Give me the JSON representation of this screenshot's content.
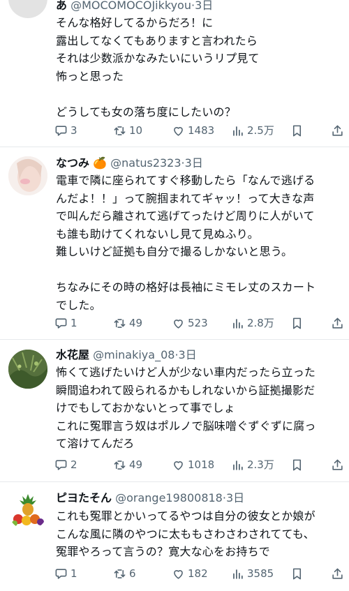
{
  "tweets": [
    {
      "name": "あ",
      "emoji": "",
      "handle": "@MOCOMOCOJikkyou",
      "time": "3日",
      "body": "そんな格好してるからだろ！に\n露出してなくてもありますと言われたら\nそれは少数派かなみたいにいうリプ見て\n怖っと思った\n\nどうしても女の落ち度にしたいの？",
      "replies": "3",
      "retweets": "10",
      "likes": "1483",
      "views": "2.5万"
    },
    {
      "name": "なつみ",
      "emoji": "🍊",
      "handle": "@natus2323",
      "time": "3日",
      "body": "電車で隣に座られてすぐ移動したら「なんで逃げる\nんだよ！！」って腕掴まれてギャッ！って大きな声\nで叫んだら離されて逃げてったけど周りに人がいて\nも誰も助けてくれないし見て見ぬふり。\n難しいけど証拠も自分で撮るしかないと思う。\n\nちなみにその時の格好は長袖にミモレ丈のスカート\nでした。",
      "replies": "1",
      "retweets": "49",
      "likes": "523",
      "views": "2.8万"
    },
    {
      "name": "水花屋",
      "emoji": "",
      "handle": "@minakiya_08",
      "time": "3日",
      "body": "怖くて逃げたいけど人が少ない車内だったら立った\n瞬間追われて殴られるかもしれないから証拠撮影だ\nけでもしておかないとって事でしょ\nこれに冤罪言う奴はポルノで脳味噌ぐずぐずに腐っ\nて溶けてんだろ",
      "replies": "2",
      "retweets": "49",
      "likes": "1018",
      "views": "2.3万"
    },
    {
      "name": "ピヨたそん",
      "emoji": "",
      "handle": "@orange19800818",
      "time": "3日",
      "body": "これも冤罪とかいってるやつは自分の彼女とか娘が\nこんな風に隣のやつに太ももさわさわされてても、\n冤罪やろって言うの？寛大な心をお持ちで",
      "replies": "1",
      "retweets": "6",
      "likes": "182",
      "views": "3585"
    }
  ],
  "colors": {
    "text": "#0f1419",
    "secondary": "#536471",
    "separator": "#e6e9ec"
  },
  "icons": [
    "reply-icon",
    "retweet-icon",
    "like-icon",
    "views-icon",
    "bookmark-icon",
    "share-icon"
  ]
}
